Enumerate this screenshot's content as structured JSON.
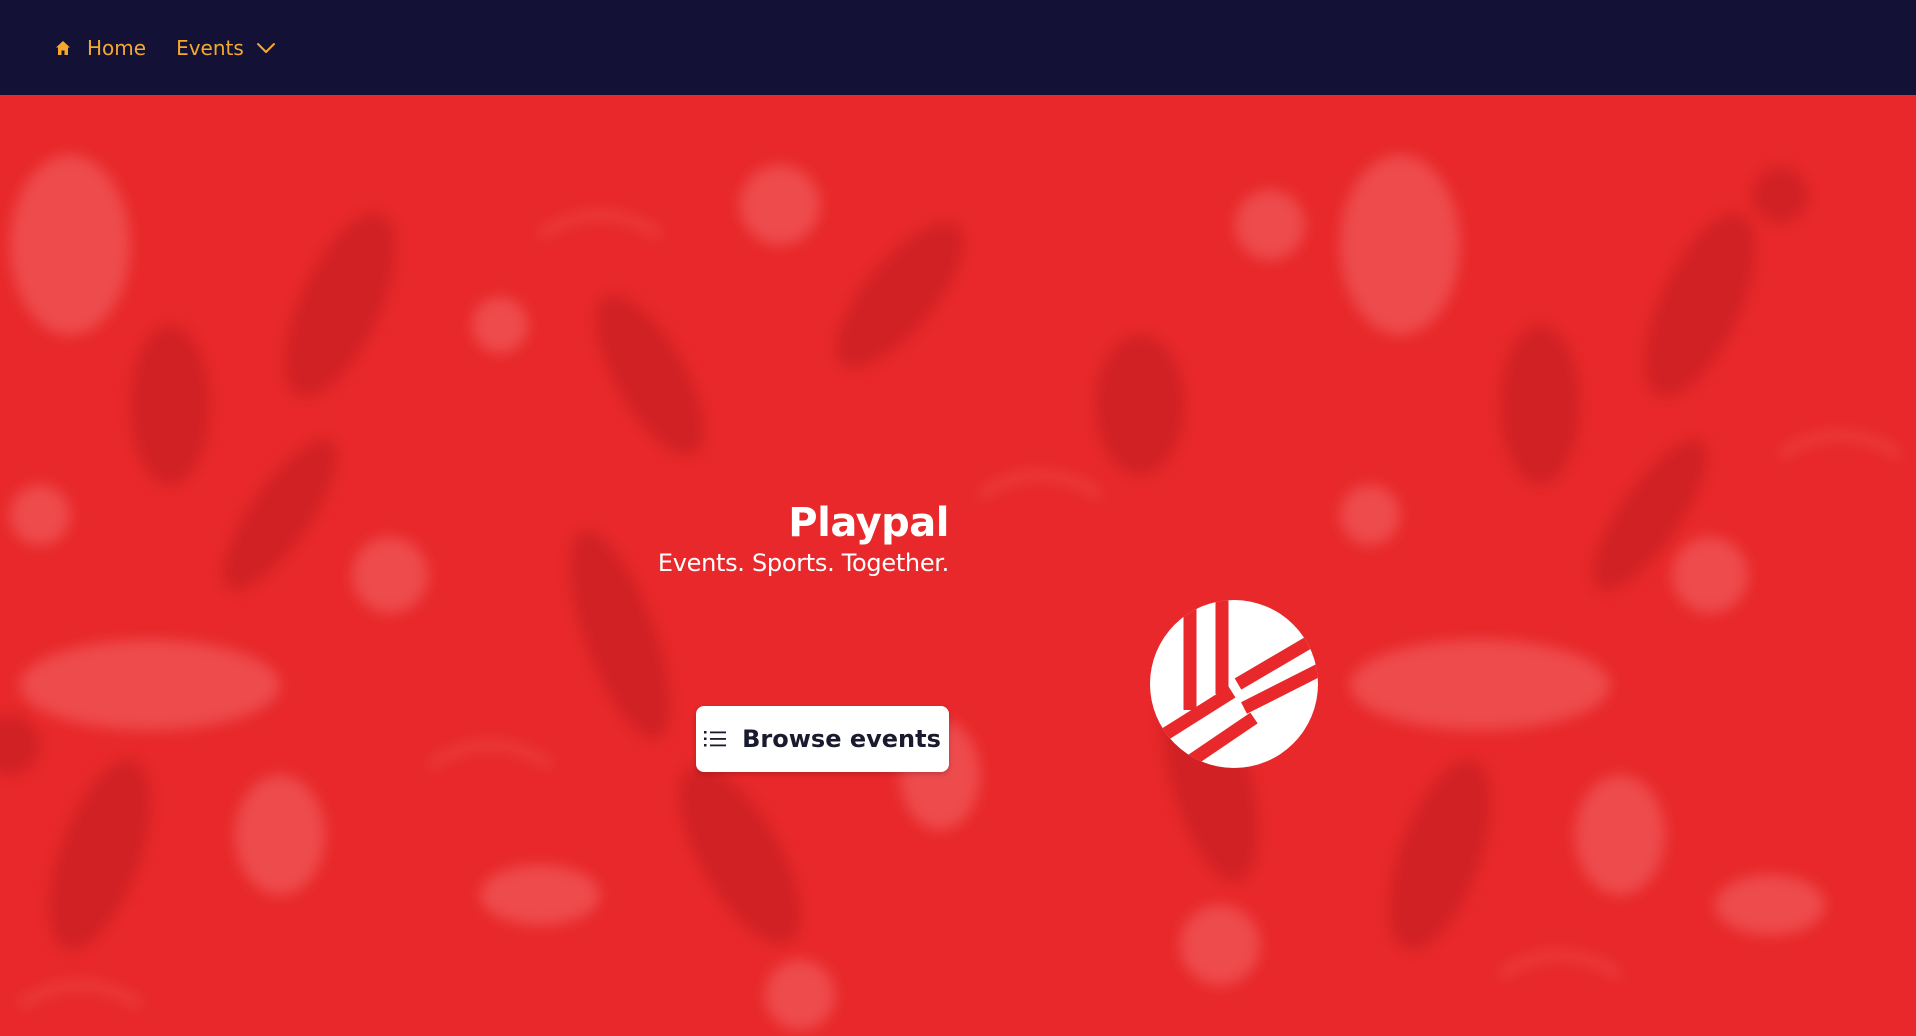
{
  "nav": {
    "home_label": "Home",
    "home_icon": "home-icon",
    "events_label": "Events",
    "events_icon": "chevron-down-icon"
  },
  "hero": {
    "title": "Playpal",
    "tagline": "Events. Sports. Together.",
    "browse_label": "Browse events",
    "browse_icon": "list-icon",
    "logo_icon": "volleyball-logo-icon"
  },
  "colors": {
    "nav_bg": "#131236",
    "nav_text": "#f4a92e",
    "hero_bg": "#e8282a",
    "button_bg": "#ffffff",
    "button_text": "#1a1a2e"
  }
}
